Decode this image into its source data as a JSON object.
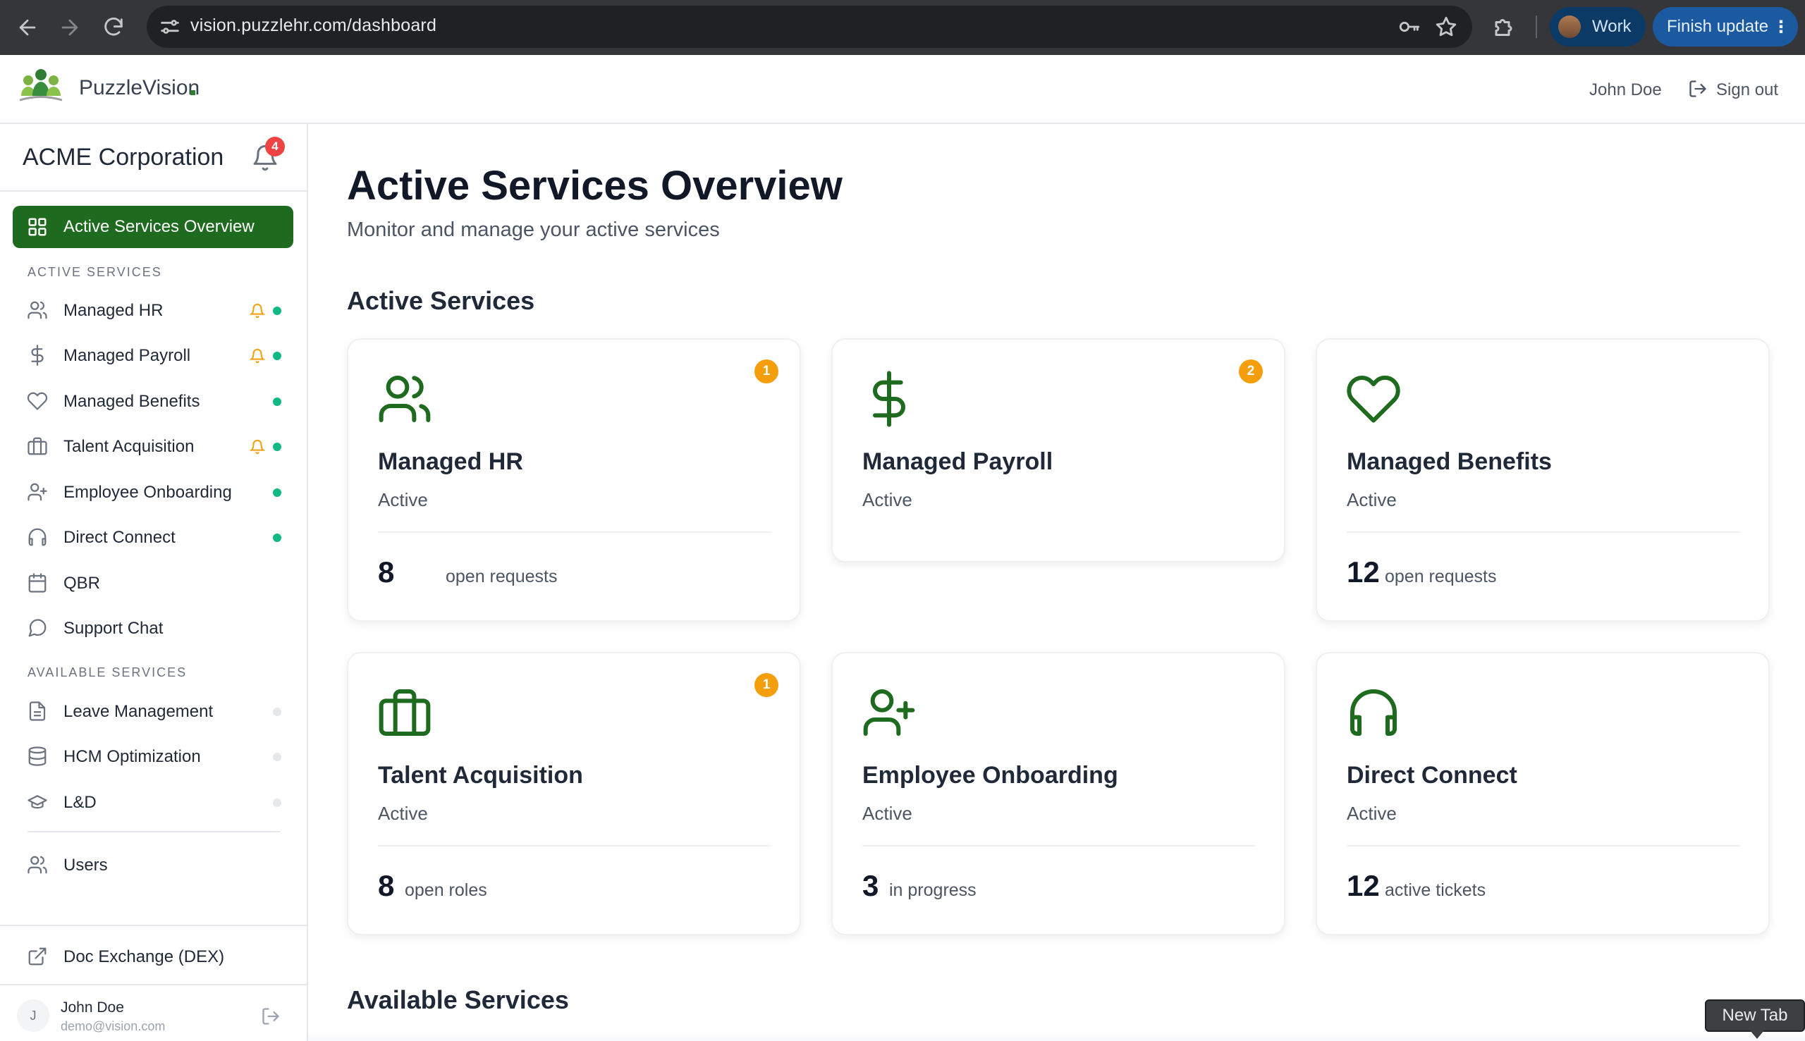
{
  "browser": {
    "url": "vision.puzzlehr.com/dashboard",
    "profile_label": "Work",
    "update_label": "Finish update",
    "update_menu_glyph": "⋮",
    "tooltip": "New Tab"
  },
  "header": {
    "brand": "PuzzleVision",
    "user_name": "John Doe",
    "signout_label": "Sign out"
  },
  "sidebar": {
    "org_name": "ACME Corporation",
    "notification_count": "4",
    "overview_label": "Active Services Overview",
    "active_section_label": "ACTIVE SERVICES",
    "active_items": [
      {
        "label": "Managed HR",
        "icon": "users-icon",
        "alert": true,
        "status": "active"
      },
      {
        "label": "Managed Payroll",
        "icon": "dollar-icon",
        "alert": true,
        "status": "active"
      },
      {
        "label": "Managed Benefits",
        "icon": "heart-icon",
        "alert": false,
        "status": "active"
      },
      {
        "label": "Talent Acquisition",
        "icon": "briefcase-icon",
        "alert": true,
        "status": "active"
      },
      {
        "label": "Employee Onboarding",
        "icon": "user-plus-icon",
        "alert": false,
        "status": "active"
      },
      {
        "label": "Direct Connect",
        "icon": "headphones-icon",
        "alert": false,
        "status": "active"
      },
      {
        "label": "QBR",
        "icon": "calendar-icon",
        "alert": false,
        "status": "none"
      },
      {
        "label": "Support Chat",
        "icon": "chat-icon",
        "alert": false,
        "status": "none"
      }
    ],
    "available_section_label": "AVAILABLE SERVICES",
    "available_items": [
      {
        "label": "Leave Management",
        "icon": "document-icon",
        "status": "inactive"
      },
      {
        "label": "HCM Optimization",
        "icon": "database-icon",
        "status": "inactive"
      },
      {
        "label": "L&D",
        "icon": "graduation-cap-icon",
        "status": "inactive"
      }
    ],
    "users_label": "Users",
    "doc_exchange_label": "Doc Exchange (DEX)",
    "user": {
      "initial": "J",
      "name": "John Doe",
      "email": "demo@vision.com"
    }
  },
  "main": {
    "title": "Active Services Overview",
    "subtitle": "Monitor and manage your active services",
    "active_section_title": "Active Services",
    "available_section_title": "Available Services",
    "cards": [
      {
        "name": "Managed HR",
        "icon": "users-icon",
        "status": "Active",
        "badge": "1",
        "count": "8",
        "unit": "open requests"
      },
      {
        "name": "Managed Payroll",
        "icon": "dollar-icon",
        "status": "Active",
        "badge": "2",
        "count": "",
        "unit": ""
      },
      {
        "name": "Managed Benefits",
        "icon": "heart-icon",
        "status": "Active",
        "badge": "",
        "count": "12",
        "unit": "open requests"
      },
      {
        "name": "Talent Acquisition",
        "icon": "briefcase-icon",
        "status": "Active",
        "badge": "1",
        "count": "8",
        "unit": "open roles"
      },
      {
        "name": "Employee Onboarding",
        "icon": "user-plus-icon",
        "status": "Active",
        "badge": "",
        "count": "3",
        "unit": "in progress"
      },
      {
        "name": "Direct Connect",
        "icon": "headphones-icon",
        "status": "Active",
        "badge": "",
        "count": "12",
        "unit": "active tickets"
      }
    ]
  },
  "colors": {
    "brand_green": "#1e6b1f",
    "badge_orange": "#f59e0b",
    "status_green": "#10b981",
    "notification_red": "#ef4444"
  }
}
